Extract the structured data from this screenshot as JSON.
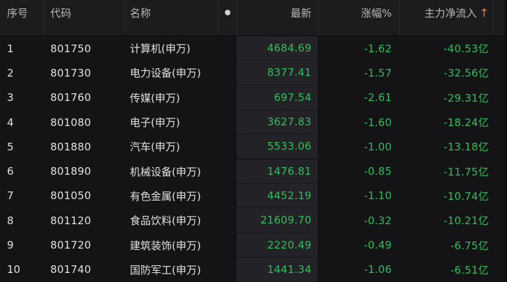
{
  "header": {
    "index": "序号",
    "code": "代码",
    "name": "名称",
    "latest": "最新",
    "change_pct": "涨幅%",
    "main_flow": "主力净流入",
    "sort_indicator": "↑"
  },
  "rows": [
    {
      "index": "1",
      "code": "801750",
      "name": "计算机(申万)",
      "latest": "4684.69",
      "change_pct": "-1.62",
      "main_flow": "-40.53亿"
    },
    {
      "index": "2",
      "code": "801730",
      "name": "电力设备(申万)",
      "latest": "8377.41",
      "change_pct": "-1.57",
      "main_flow": "-32.56亿"
    },
    {
      "index": "3",
      "code": "801760",
      "name": "传媒(申万)",
      "latest": "697.54",
      "change_pct": "-2.61",
      "main_flow": "-29.31亿"
    },
    {
      "index": "4",
      "code": "801080",
      "name": "电子(申万)",
      "latest": "3627.83",
      "change_pct": "-1.60",
      "main_flow": "-18.24亿"
    },
    {
      "index": "5",
      "code": "801880",
      "name": "汽车(申万)",
      "latest": "5533.06",
      "change_pct": "-1.00",
      "main_flow": "-13.18亿"
    },
    {
      "index": "6",
      "code": "801890",
      "name": "机械设备(申万)",
      "latest": "1476.81",
      "change_pct": "-0.85",
      "main_flow": "-11.75亿"
    },
    {
      "index": "7",
      "code": "801050",
      "name": "有色金属(申万)",
      "latest": "4452.19",
      "change_pct": "-1.10",
      "main_flow": "-10.74亿"
    },
    {
      "index": "8",
      "code": "801120",
      "name": "食品饮料(申万)",
      "latest": "21609.70",
      "change_pct": "-0.32",
      "main_flow": "-10.21亿"
    },
    {
      "index": "9",
      "code": "801720",
      "name": "建筑装饰(申万)",
      "latest": "2220.49",
      "change_pct": "-0.49",
      "main_flow": "-6.75亿"
    },
    {
      "index": "10",
      "code": "801740",
      "name": "国防军工(申万)",
      "latest": "1441.34",
      "change_pct": "-1.06",
      "main_flow": "-6.51亿"
    }
  ],
  "colors": {
    "background": "#141416",
    "header_background": "#1c1c1f",
    "negative": "#2fbf5a",
    "sort_arrow": "#ff7a1a"
  }
}
